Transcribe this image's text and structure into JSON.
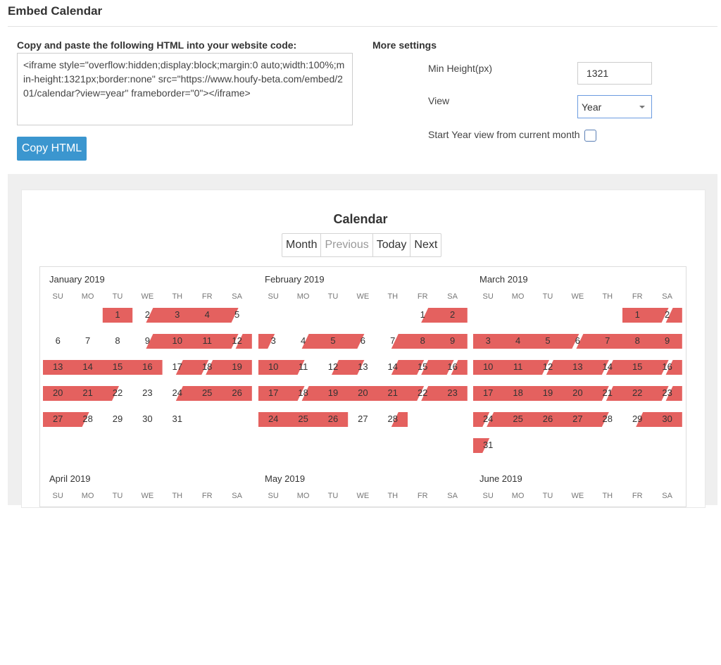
{
  "header": {
    "title": "Embed Calendar"
  },
  "embed": {
    "label": "Copy and paste the following HTML into your website code:",
    "code": "<iframe style=\"overflow:hidden;display:block;margin:0 auto;width:100%;min-height:1321px;border:none\" src=\"https://www.houfy-beta.com/embed/201/calendar?view=year\" frameborder=\"0\"></iframe>",
    "copy_button": "Copy HTML"
  },
  "settings": {
    "title": "More settings",
    "min_height_label": "Min Height(px)",
    "min_height_value": "1321",
    "view_label": "View",
    "view_value": "Year",
    "start_label": "Start Year view from current month",
    "start_checked": false
  },
  "calendar": {
    "title": "Calendar",
    "buttons": [
      "Month",
      "Previous",
      "Today",
      "Next"
    ],
    "disabled_button": "Previous",
    "weekdays": [
      "SU",
      "MO",
      "TU",
      "WE",
      "TH",
      "FR",
      "SA"
    ],
    "booked_color": "#e4615f",
    "months": [
      {
        "title": "January 2019",
        "year": 2019,
        "month": 1,
        "bookings": [
          {
            "start": 1,
            "end": 1,
            "start_edge": "full",
            "end_edge": "full"
          },
          {
            "start": 2,
            "end": 5,
            "start_edge": "half",
            "end_edge": "half"
          },
          {
            "start": 9,
            "end": 12,
            "start_edge": "half",
            "end_edge": "half"
          },
          {
            "start": 12,
            "end": 16,
            "start_edge": "half",
            "end_edge": "full"
          },
          {
            "start": 17,
            "end": 18,
            "start_edge": "half",
            "end_edge": "half"
          },
          {
            "start": 18,
            "end": 22,
            "start_edge": "half",
            "end_edge": "half"
          },
          {
            "start": 24,
            "end": 28,
            "start_edge": "half",
            "end_edge": "half"
          }
        ]
      },
      {
        "title": "February 2019",
        "year": 2019,
        "month": 2,
        "bookings": [
          {
            "start": 1,
            "end": 3,
            "start_edge": "half",
            "end_edge": "half"
          },
          {
            "start": 4,
            "end": 6,
            "start_edge": "half",
            "end_edge": "half"
          },
          {
            "start": 7,
            "end": 11,
            "start_edge": "half",
            "end_edge": "half"
          },
          {
            "start": 12,
            "end": 13,
            "start_edge": "half",
            "end_edge": "half"
          },
          {
            "start": 14,
            "end": 15,
            "start_edge": "half",
            "end_edge": "half"
          },
          {
            "start": 15,
            "end": 16,
            "start_edge": "half",
            "end_edge": "half"
          },
          {
            "start": 16,
            "end": 18,
            "start_edge": "half",
            "end_edge": "half"
          },
          {
            "start": 18,
            "end": 22,
            "start_edge": "half",
            "end_edge": "half"
          },
          {
            "start": 22,
            "end": 26,
            "start_edge": "half",
            "end_edge": "full"
          },
          {
            "start": 28,
            "end": 28,
            "start_edge": "half",
            "end_edge": "full"
          }
        ]
      },
      {
        "title": "March 2019",
        "year": 2019,
        "month": 3,
        "bookings": [
          {
            "start": 1,
            "end": 2,
            "start_edge": "full",
            "end_edge": "half"
          },
          {
            "start": 2,
            "end": 6,
            "start_edge": "half",
            "end_edge": "half"
          },
          {
            "start": 6,
            "end": 12,
            "start_edge": "half",
            "end_edge": "half"
          },
          {
            "start": 12,
            "end": 14,
            "start_edge": "half",
            "end_edge": "half"
          },
          {
            "start": 14,
            "end": 16,
            "start_edge": "half",
            "end_edge": "half"
          },
          {
            "start": 16,
            "end": 21,
            "start_edge": "half",
            "end_edge": "half"
          },
          {
            "start": 21,
            "end": 23,
            "start_edge": "half",
            "end_edge": "half"
          },
          {
            "start": 23,
            "end": 24,
            "start_edge": "half",
            "end_edge": "half"
          },
          {
            "start": 24,
            "end": 28,
            "start_edge": "half",
            "end_edge": "half"
          },
          {
            "start": 29,
            "end": 31,
            "start_edge": "half",
            "end_edge": "half"
          }
        ]
      },
      {
        "title": "April 2019",
        "year": 2019,
        "month": 4,
        "bookings": []
      },
      {
        "title": "May 2019",
        "year": 2019,
        "month": 5,
        "bookings": []
      },
      {
        "title": "June 2019",
        "year": 2019,
        "month": 6,
        "bookings": []
      }
    ]
  }
}
